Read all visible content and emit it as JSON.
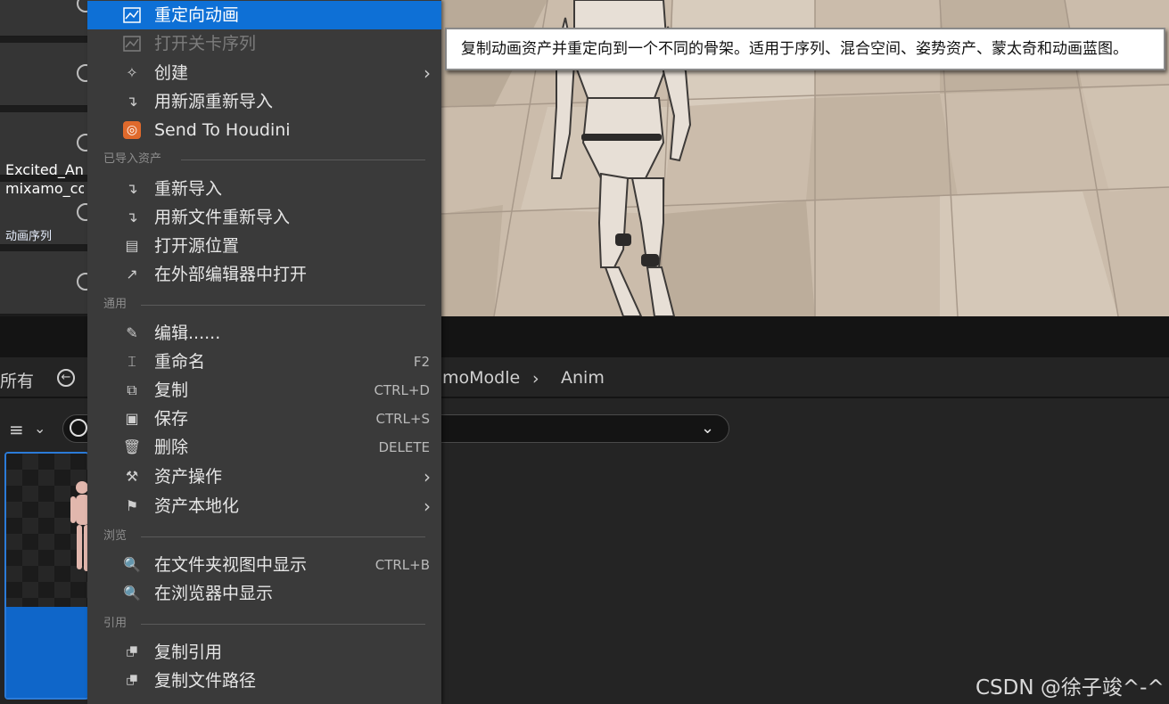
{
  "tooltip": {
    "text": "复制动画资产并重定向到一个不同的骨架。适用于序列、混合空间、姿势资产、蒙太奇和动画蓝图。"
  },
  "breadcrumb": {
    "left_label": "所有",
    "items": [
      "moModle",
      "Anim"
    ]
  },
  "asset": {
    "name_line1": "Excited_An",
    "name_line2": "mixamo_co",
    "type": "动画序列"
  },
  "menu": {
    "top_items": [
      {
        "label": "重定向动画",
        "icon": "retarget-icon",
        "state": "selected"
      },
      {
        "label": "打开关卡序列",
        "icon": "level-sequence-icon",
        "state": "disabled"
      },
      {
        "label": "创建",
        "icon": "create-icon",
        "submenu": true
      },
      {
        "label": "用新源重新导入",
        "icon": "reimport-icon"
      },
      {
        "label": "Send To Houdini",
        "icon": "houdini-icon"
      }
    ],
    "sections": [
      {
        "title": "已导入资产",
        "items": [
          {
            "label": "重新导入",
            "icon": "reimport-icon"
          },
          {
            "label": "用新文件重新导入",
            "icon": "reimport-icon"
          },
          {
            "label": "打开源位置",
            "icon": "open-folder-icon"
          },
          {
            "label": "在外部编辑器中打开",
            "icon": "external-editor-icon"
          }
        ]
      },
      {
        "title": "通用",
        "items": [
          {
            "label": "编辑......",
            "icon": "pencil-icon"
          },
          {
            "label": "重命名",
            "icon": "rename-icon",
            "shortcut": "F2"
          },
          {
            "label": "复制",
            "icon": "duplicate-icon",
            "shortcut": "CTRL+D"
          },
          {
            "label": "保存",
            "icon": "save-icon",
            "shortcut": "CTRL+S"
          },
          {
            "label": "删除",
            "icon": "trash-icon",
            "shortcut": "DELETE"
          },
          {
            "label": "资产操作",
            "icon": "wrench-icon",
            "submenu": true
          },
          {
            "label": "资产本地化",
            "icon": "flag-icon",
            "submenu": true
          }
        ]
      },
      {
        "title": "浏览",
        "items": [
          {
            "label": "在文件夹视图中显示",
            "icon": "folder-search-icon",
            "shortcut": "CTRL+B"
          },
          {
            "label": "在浏览器中显示",
            "icon": "folder-search-icon"
          }
        ]
      },
      {
        "title": "引用",
        "items": [
          {
            "label": "复制引用",
            "icon": "copy-reference-icon"
          },
          {
            "label": "复制文件路径",
            "icon": "copy-path-icon"
          }
        ]
      }
    ]
  },
  "watermark": "CSDN @徐子竣^-^",
  "colors": {
    "selection": "#0e70d6",
    "menu_bg": "#3a3a3a",
    "asset_highlight": "#0f66c9"
  }
}
